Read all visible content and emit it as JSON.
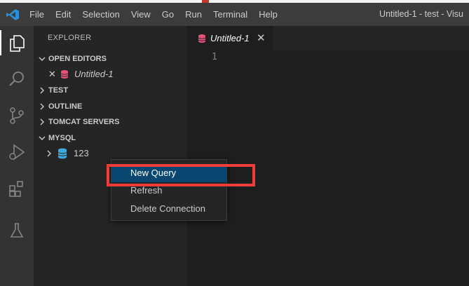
{
  "menu": [
    "File",
    "Edit",
    "Selection",
    "View",
    "Go",
    "Run",
    "Terminal",
    "Help"
  ],
  "window_title": "Untitled-1 - test - Visu",
  "sidebar": {
    "title": "EXPLORER",
    "open_editors_label": "OPEN EDITORS",
    "open_file": "Untitled-1",
    "sections": [
      "TEST",
      "OUTLINE",
      "TOMCAT SERVERS",
      "MYSQL"
    ],
    "connection_name": "123"
  },
  "editor": {
    "tab_label": "Untitled-1",
    "line_number": "1"
  },
  "context_menu": {
    "items": [
      "New Query",
      "Refresh",
      "Delete Connection"
    ],
    "selected": "New Query"
  },
  "colors": {
    "accent": "#094771",
    "highlight": "#f03c3c",
    "file_icon": "#e2537a",
    "db_icon": "#3fa9dc"
  }
}
